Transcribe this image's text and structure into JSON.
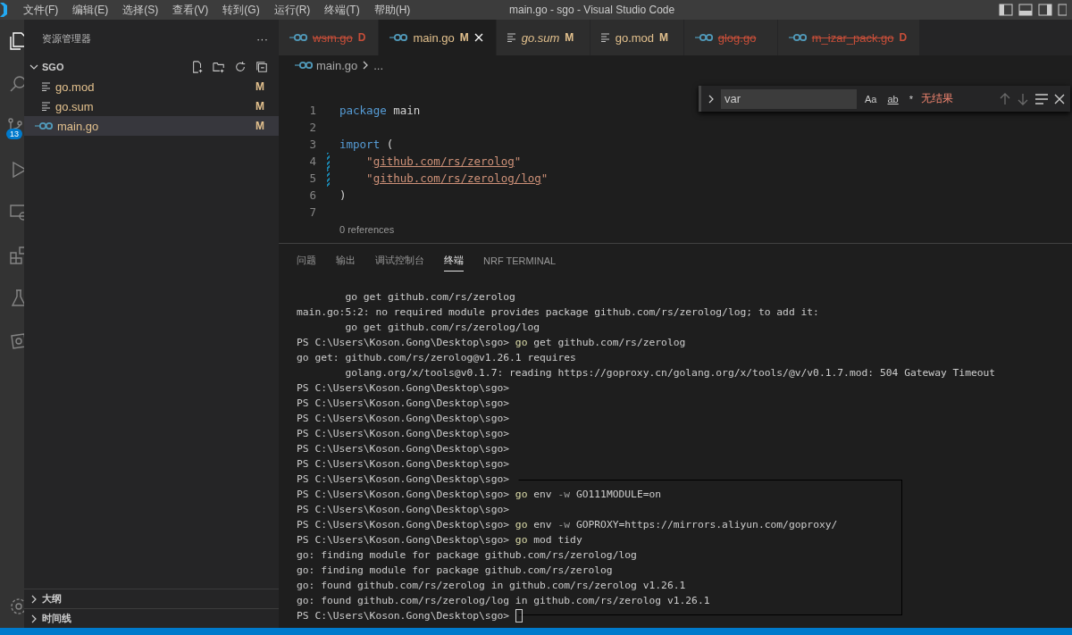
{
  "window": {
    "title": "main.go - sgo - Visual Studio Code"
  },
  "menu": [
    "文件(F)",
    "编辑(E)",
    "选择(S)",
    "查看(V)",
    "转到(G)",
    "运行(R)",
    "终端(T)",
    "帮助(H)"
  ],
  "activity_bar": [
    {
      "kind": "files",
      "selected": true
    },
    {
      "kind": "search",
      "selected": false
    },
    {
      "kind": "source-control",
      "selected": false,
      "badge": "13"
    },
    {
      "kind": "run",
      "selected": false
    },
    {
      "kind": "remote",
      "selected": false
    },
    {
      "kind": "extensions",
      "selected": false
    },
    {
      "kind": "testing",
      "selected": false
    },
    {
      "kind": "plugin",
      "selected": false
    }
  ],
  "sidebar": {
    "title": "资源管理器",
    "more": "···",
    "folder": {
      "name": "SGO",
      "expanded": true
    },
    "files": [
      {
        "name": "go.mod",
        "kind": "text",
        "status": "M",
        "selected": false
      },
      {
        "name": "go.sum",
        "kind": "text",
        "status": "M",
        "selected": false
      },
      {
        "name": "main.go",
        "kind": "go",
        "status": "M",
        "selected": true
      }
    ],
    "sections": [
      {
        "title": "大纲",
        "expanded": false
      },
      {
        "title": "时间线",
        "expanded": false
      }
    ]
  },
  "tabs": [
    {
      "label": "wsm.go",
      "kind": "go",
      "deleted": true,
      "italic": false,
      "status": "D",
      "selected": false
    },
    {
      "label": "main.go",
      "kind": "go",
      "deleted": false,
      "italic": false,
      "status": "M",
      "selected": true
    },
    {
      "label": "go.sum",
      "kind": "text",
      "deleted": false,
      "italic": true,
      "status": "M",
      "selected": false
    },
    {
      "label": "go.mod",
      "kind": "text",
      "deleted": false,
      "italic": false,
      "status": "M",
      "selected": false
    },
    {
      "label": "glog.go",
      "kind": "go",
      "deleted": true,
      "italic": false,
      "selected": false
    },
    {
      "label": "m_izar_pack.go",
      "kind": "go",
      "deleted": true,
      "italic": false,
      "status": "D",
      "selected": false
    }
  ],
  "breadcrumb": {
    "file": "main.go",
    "rest": "..."
  },
  "find": {
    "value": "var",
    "result": "无结果",
    "options": [
      "Aa",
      "ab",
      "*"
    ]
  },
  "code": [
    {
      "number": "1",
      "changed": false,
      "tokens": [
        {
          "kind": "keyword",
          "text": "package"
        },
        {
          "kind": "plain",
          "text": " main"
        }
      ]
    },
    {
      "number": "2",
      "changed": false
    },
    {
      "number": "3",
      "changed": false,
      "tokens": [
        {
          "kind": "keyword",
          "text": "import"
        },
        {
          "kind": "plain",
          "text": " ("
        }
      ]
    },
    {
      "number": "4",
      "changed": true,
      "tokens": [
        {
          "kind": "quote",
          "text": "    \""
        },
        {
          "kind": "link",
          "text": "github.com/rs/zerolog"
        },
        {
          "kind": "quote",
          "text": "\""
        }
      ]
    },
    {
      "number": "5",
      "changed": true,
      "tokens": [
        {
          "kind": "quote",
          "text": "    \""
        },
        {
          "kind": "link",
          "text": "github.com/rs/zerolog/log"
        },
        {
          "kind": "quote",
          "text": "\""
        }
      ]
    },
    {
      "number": "6",
      "changed": false,
      "tokens": [
        {
          "kind": "plain",
          "text": ")"
        }
      ]
    },
    {
      "number": "7",
      "changed": false
    }
  ],
  "codelens": "0 references",
  "panel_tabs": [
    {
      "label": "问题",
      "selected": false
    },
    {
      "label": "输出",
      "selected": false
    },
    {
      "label": "调试控制台",
      "selected": false
    },
    {
      "label": "终端",
      "selected": true
    },
    {
      "label": "NRF TERMINAL",
      "selected": false
    }
  ],
  "terminal": [
    {
      "text": "        go get github.com/rs/zerolog"
    },
    {
      "text": "main.go:5:2: no required module provides package github.com/rs/zerolog/log; to add it:"
    },
    {
      "text": "        go get github.com/rs/zerolog/log"
    },
    {
      "prompt": "PS C:\\Users\\Koson.Gong\\Desktop\\sgo>",
      "command": [
        {
          "kind": "program",
          "text": "go"
        },
        {
          "kind": "arg",
          "text": "get"
        },
        {
          "kind": "arg",
          "text": "github.com/rs/zerolog"
        }
      ]
    },
    {
      "text": "go get: github.com/rs/zerolog@v1.26.1 requires"
    },
    {
      "text": "        golang.org/x/tools@v0.1.7: reading https://goproxy.cn/golang.org/x/tools/@v/v0.1.7.mod: 504 Gateway Timeout"
    },
    {
      "prompt": "PS C:\\Users\\Koson.Gong\\Desktop\\sgo>"
    },
    {
      "prompt": "PS C:\\Users\\Koson.Gong\\Desktop\\sgo>"
    },
    {
      "prompt": "PS C:\\Users\\Koson.Gong\\Desktop\\sgo>"
    },
    {
      "prompt": "PS C:\\Users\\Koson.Gong\\Desktop\\sgo>"
    },
    {
      "prompt": "PS C:\\Users\\Koson.Gong\\Desktop\\sgo>"
    },
    {
      "prompt": "PS C:\\Users\\Koson.Gong\\Desktop\\sgo>"
    },
    {
      "prompt": "PS C:\\Users\\Koson.Gong\\Desktop\\sgo>"
    },
    {
      "prompt": "PS C:\\Users\\Koson.Gong\\Desktop\\sgo>",
      "command": [
        {
          "kind": "program",
          "text": "go"
        },
        {
          "kind": "arg",
          "text": "env"
        },
        {
          "kind": "flag",
          "text": "-w"
        },
        {
          "kind": "arg",
          "text": "GO111MODULE=on"
        }
      ]
    },
    {
      "prompt": "PS C:\\Users\\Koson.Gong\\Desktop\\sgo>"
    },
    {
      "prompt": "PS C:\\Users\\Koson.Gong\\Desktop\\sgo>",
      "command": [
        {
          "kind": "program",
          "text": "go"
        },
        {
          "kind": "arg",
          "text": "env"
        },
        {
          "kind": "flag",
          "text": "-w"
        },
        {
          "kind": "arg",
          "text": "GOPROXY=https://mirrors.aliyun.com/goproxy/"
        }
      ]
    },
    {
      "prompt": "PS C:\\Users\\Koson.Gong\\Desktop\\sgo>",
      "command": [
        {
          "kind": "program",
          "text": "go"
        },
        {
          "kind": "arg",
          "text": "mod"
        },
        {
          "kind": "arg",
          "text": "tidy"
        }
      ]
    },
    {
      "text": "go: finding module for package github.com/rs/zerolog/log"
    },
    {
      "text": "go: finding module for package github.com/rs/zerolog"
    },
    {
      "text": "go: found github.com/rs/zerolog in github.com/rs/zerolog v1.26.1"
    },
    {
      "text": "go: found github.com/rs/zerolog/log in github.com/rs/zerolog v1.26.1"
    },
    {
      "prompt": "PS C:\\Users\\Koson.Gong\\Desktop\\sgo>",
      "cursor": true
    }
  ]
}
